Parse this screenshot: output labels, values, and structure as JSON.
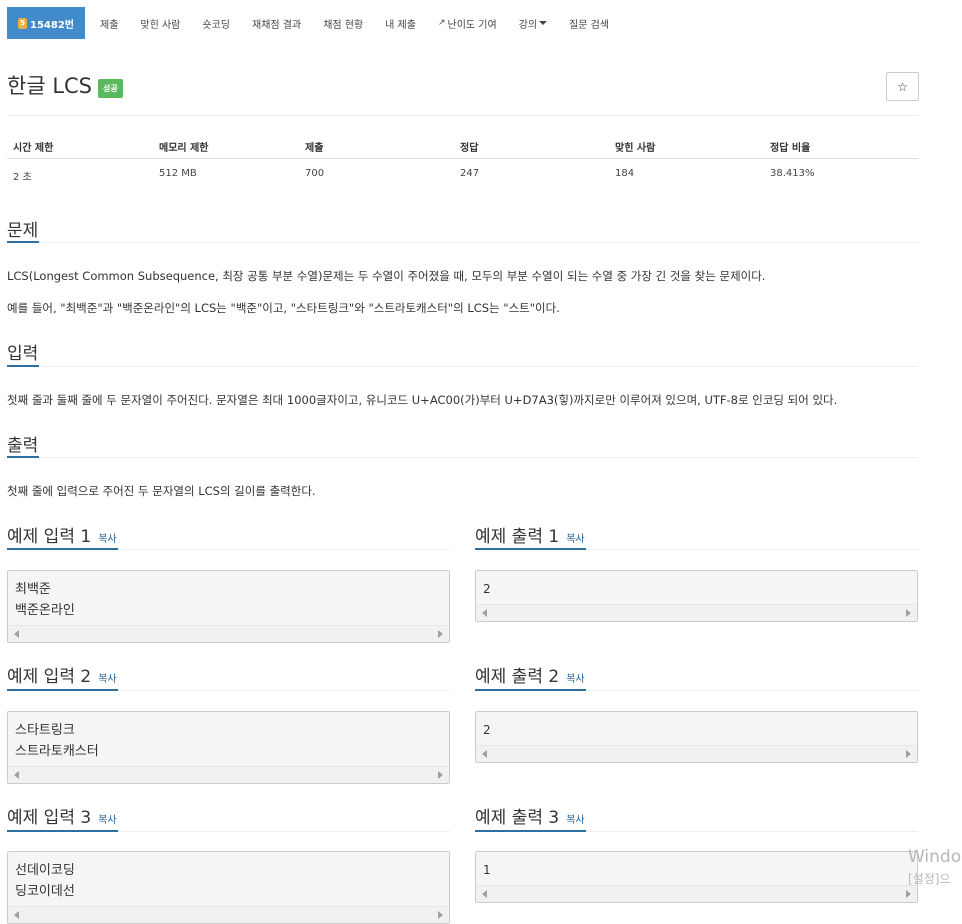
{
  "nav": {
    "active": "15482번",
    "items": [
      "제출",
      "맞힌 사람",
      "숏코딩",
      "재채점 결과",
      "채점 현황",
      "내 제출",
      "난이도 기여",
      "강의",
      "질문 검색"
    ]
  },
  "problem": {
    "title": "한글 LCS",
    "status_badge": "성공",
    "star": "☆"
  },
  "info_table": {
    "headers": [
      "시간 제한",
      "메모리 제한",
      "제출",
      "정답",
      "맞힌 사람",
      "정답 비율"
    ],
    "values": [
      "2 초",
      "512 MB",
      "700",
      "247",
      "184",
      "38.413%"
    ]
  },
  "sections": {
    "problem_heading": "문제",
    "problem_p1": "LCS(Longest Common Subsequence, 최장 공통 부분 수열)문제는 두 수열이 주어졌을 때, 모두의 부분 수열이 되는 수열 중 가장 긴 것을 찾는 문제이다.",
    "problem_p2": "예를 들어, \"최백준\"과 \"백준온라인\"의 LCS는 \"백준\"이고, \"스타트링크\"와 \"스트라토캐스터\"의 LCS는 \"스트\"이다.",
    "input_heading": "입력",
    "input_p": "첫째 줄과 둘째 줄에 두 문자열이 주어진다. 문자열은 최대 1000글자이고, 유니코드 U+AC00(가)부터 U+D7A3(힣)까지로만 이루어져 있으며, UTF-8로 인코딩 되어 있다.",
    "output_heading": "출력",
    "output_p": "첫째 줄에 입력으로 주어진 두 문자열의 LCS의 길이를 출력한다."
  },
  "samples": {
    "copy_label": "복사",
    "input_1_title": "예제 입력 1",
    "input_1": "최백준\n백준온라인",
    "output_1_title": "예제 출력 1",
    "output_1": "2",
    "input_2_title": "예제 입력 2",
    "input_2": "스타트링크\n스트라토캐스터",
    "output_2_title": "예제 출력 2",
    "output_2": "2",
    "input_3_title": "예제 입력 3",
    "input_3": "선데이코딩\n딩코이데선",
    "output_3_title": "예제 출력 3",
    "output_3": "1"
  },
  "watermark": {
    "line1": "Windo",
    "line2": "[설정]으"
  },
  "colors": {
    "accent": "#428bca",
    "success": "#5cb85c",
    "link": "#2a6496"
  }
}
